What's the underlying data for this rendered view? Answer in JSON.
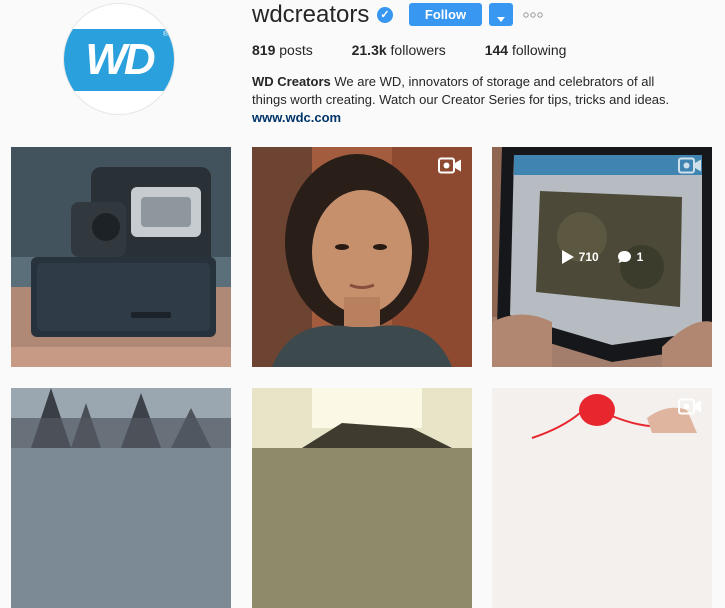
{
  "profile": {
    "username": "wdcreators",
    "verified_icon": "verified-badge-icon",
    "avatar_logo_text": "WD",
    "avatar_registered_mark": "®",
    "follow_label": "Follow",
    "stats": {
      "posts_count": "819",
      "posts_label": "posts",
      "followers_count": "21.3k",
      "followers_label": "followers",
      "following_count": "144",
      "following_label": "following"
    },
    "bio": {
      "name": "WD Creators",
      "text": " We are WD, innovators of storage and celebrators of all things worth creating. Watch our Creator Series for tips, tricks and ideas. ",
      "link": "www.wdc.com"
    }
  },
  "colors": {
    "accent": "#3897f0",
    "brand_logo": "#2aa0dc",
    "link": "#003569",
    "background": "#fafafa"
  },
  "posts": [
    {
      "type": "image",
      "subject": "hard drive and camera",
      "icon": null
    },
    {
      "type": "video",
      "subject": "woman portrait",
      "icon": "video-camera-icon"
    },
    {
      "type": "video",
      "subject": "tablet with video",
      "icon": "video-camera-icon",
      "hover": {
        "views": "710",
        "comments": "1",
        "play_icon": "play-icon",
        "comment_icon": "comment-icon"
      }
    },
    {
      "type": "image",
      "subject": "gothic castle",
      "icon": null
    },
    {
      "type": "image",
      "subject": "lamp",
      "icon": null
    },
    {
      "type": "video",
      "subject": "red yarn hand",
      "icon": "video-camera-icon"
    }
  ]
}
